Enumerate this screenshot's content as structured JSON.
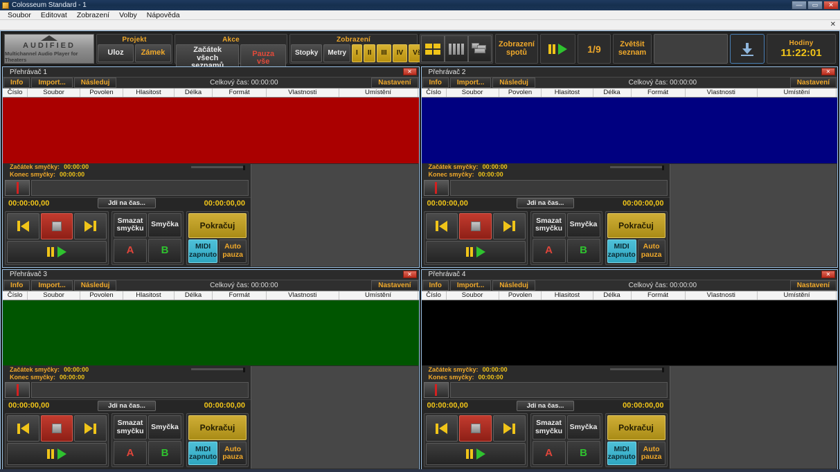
{
  "window": {
    "title": "Colosseum Standard - 1",
    "minimize": "—",
    "maximize": "▭",
    "close": "✕",
    "sub_close": "✕"
  },
  "menubar": {
    "items": [
      "Soubor",
      "Editovat",
      "Zobrazení",
      "Volby",
      "Nápověda"
    ]
  },
  "toolbar": {
    "logo": {
      "word": "AUDIFIED",
      "tagline": "Multichannel Audio Player for Theaters"
    },
    "projekt": {
      "label": "Projekt",
      "save": "Uloz",
      "lock": "Zámek"
    },
    "akce": {
      "label": "Akce",
      "start_all": "Začátek\nvšech seznamů",
      "pause_all": "Pauza vše"
    },
    "zobrazeni": {
      "label": "Zobrazení",
      "stopky": "Stopky",
      "metry": "Metry",
      "views": [
        "I",
        "II",
        "III",
        "IV"
      ],
      "vse": "Vše"
    },
    "layouts": [
      "grid-2x2",
      "columns-4",
      "cascade"
    ],
    "spots": "Zobrazení\nspotů",
    "transport_global": "pause-play",
    "page_counter": "1/9",
    "enlarge": "Zvětšit\nseznam",
    "download_icon": "download-icon",
    "clock": {
      "label": "Hodiny",
      "value": "11:22:01"
    }
  },
  "players": [
    {
      "title": "Přehrávač 1",
      "close": "✕",
      "color": "#aa0000",
      "buttons": {
        "info": "Info",
        "import": "Import...",
        "follow": "Následuj",
        "settings": "Nastavení"
      },
      "total_time": "Celkový čas: 00:00:00",
      "columns": [
        "Číslo",
        "Soubor",
        "Povolen",
        "Hlasitost",
        "Délka",
        "Formát",
        "Vlastnosti",
        "Umístění",
        ""
      ],
      "loop_start_label": "Začátek smyčky:",
      "loop_start_value": "00:00:00",
      "loop_end_label": "Konec smyčky:",
      "loop_end_value": "00:00:00",
      "time_left": "00:00:00,00",
      "goto": "Jdi na čas...",
      "time_right": "00:00:00,00",
      "transport": {
        "prev": "prev-icon",
        "stop": "stop-icon",
        "next": "next-icon",
        "playpause": "pause-play-icon",
        "clear_loop": "Smazat\nsmyčku",
        "loop": "Smyčka",
        "a": "A",
        "b": "B",
        "continue": "Pokračuj",
        "midi": "MIDI\nzapnuto",
        "auto_pause": "Auto\npauza"
      }
    },
    {
      "title": "Přehrávač 2",
      "close": "✕",
      "color": "#000080",
      "buttons": {
        "info": "Info",
        "import": "Import...",
        "follow": "Následuj",
        "settings": "Nastavení"
      },
      "total_time": "Celkový čas: 00:00:00",
      "columns": [
        "Číslo",
        "Soubor",
        "Povolen",
        "Hlasitost",
        "Délka",
        "Formát",
        "Vlastnosti",
        "Umístění",
        ""
      ],
      "loop_start_label": "Začátek smyčky:",
      "loop_start_value": "00:00:00",
      "loop_end_label": "Konec smyčky:",
      "loop_end_value": "00:00:00",
      "time_left": "00:00:00,00",
      "goto": "Jdi na čas...",
      "time_right": "00:00:00,00",
      "transport": {
        "prev": "prev-icon",
        "stop": "stop-icon",
        "next": "next-icon",
        "playpause": "pause-play-icon",
        "clear_loop": "Smazat\nsmyčku",
        "loop": "Smyčka",
        "a": "A",
        "b": "B",
        "continue": "Pokračuj",
        "midi": "MIDI\nzapnuto",
        "auto_pause": "Auto\npauza"
      }
    },
    {
      "title": "Přehrávač 3",
      "close": "✕",
      "color": "#005500",
      "buttons": {
        "info": "Info",
        "import": "Import...",
        "follow": "Následuj",
        "settings": "Nastavení"
      },
      "total_time": "Celkový čas: 00:00:00",
      "columns": [
        "Číslo",
        "Soubor",
        "Povolen",
        "Hlasitost",
        "Délka",
        "Formát",
        "Vlastnosti",
        "Umístění",
        ""
      ],
      "loop_start_label": "Začátek smyčky:",
      "loop_start_value": "00:00:00",
      "loop_end_label": "Konec smyčky:",
      "loop_end_value": "00:00:00",
      "time_left": "00:00:00,00",
      "goto": "Jdi na čas...",
      "time_right": "00:00:00,00",
      "transport": {
        "prev": "prev-icon",
        "stop": "stop-icon",
        "next": "next-icon",
        "playpause": "pause-play-icon",
        "clear_loop": "Smazat\nsmyčku",
        "loop": "Smyčka",
        "a": "A",
        "b": "B",
        "continue": "Pokračuj",
        "midi": "MIDI\nzapnuto",
        "auto_pause": "Auto\npauza"
      }
    },
    {
      "title": "Přehrávač 4",
      "close": "✕",
      "color": "#000000",
      "buttons": {
        "info": "Info",
        "import": "Import...",
        "follow": "Následuj",
        "settings": "Nastavení"
      },
      "total_time": "Celkový čas: 00:00:00",
      "columns": [
        "Číslo",
        "Soubor",
        "Povolen",
        "Hlasitost",
        "Délka",
        "Formát",
        "Vlastnosti",
        "Umístění",
        ""
      ],
      "loop_start_label": "Začátek smyčky:",
      "loop_start_value": "00:00:00",
      "loop_end_label": "Konec smyčky:",
      "loop_end_value": "00:00:00",
      "time_left": "00:00:00,00",
      "goto": "Jdi na čas...",
      "time_right": "00:00:00,00",
      "transport": {
        "prev": "prev-icon",
        "stop": "stop-icon",
        "next": "next-icon",
        "playpause": "pause-play-icon",
        "clear_loop": "Smazat\nsmyčku",
        "loop": "Smyčka",
        "a": "A",
        "b": "B",
        "continue": "Pokračuj",
        "midi": "MIDI\nzapnuto",
        "auto_pause": "Auto\npauza"
      }
    }
  ],
  "colors": {
    "accent_orange": "#f0a92b",
    "accent_yellow": "#f0c419",
    "midi_cyan": "#2fa6c0",
    "panel_red": "#aa0000",
    "panel_blue": "#000080",
    "panel_green": "#005500",
    "panel_black": "#000000"
  }
}
